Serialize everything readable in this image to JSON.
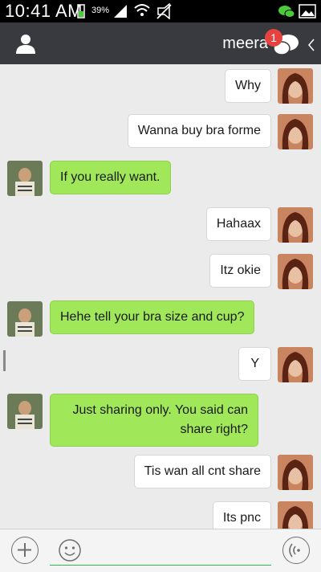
{
  "status_bar": {
    "time": "10:41 AM",
    "battery": "39%"
  },
  "header": {
    "title": "meera",
    "unread_badge": "1"
  },
  "messages": [
    {
      "side": "right",
      "text": "Why"
    },
    {
      "side": "right",
      "text": "Wanna buy bra forme"
    },
    {
      "side": "left",
      "text": "If you really want."
    },
    {
      "side": "right",
      "text": "Hahaax"
    },
    {
      "side": "right",
      "text": "Itz okie"
    },
    {
      "side": "left",
      "text": "Hehe tell your bra size and cup?"
    },
    {
      "side": "right",
      "text": "Y"
    },
    {
      "side": "left",
      "lines": [
        "Just sharing only. You said can",
        "share right?"
      ]
    },
    {
      "side": "right",
      "text": "Tis wan all cnt share"
    },
    {
      "side": "right",
      "text": "Its pnc"
    }
  ],
  "icons": {
    "back": "back-chevron-icon",
    "chat": "chat-bubbles-icon",
    "profile": "person-icon",
    "add": "plus-icon",
    "emoji": "emoji-icon",
    "voice": "voice-icon"
  },
  "colors": {
    "title_bar": "#393a3f",
    "chat_bg": "#ebebeb",
    "sent_bubble": "#a0e75a",
    "received_bubble": "#ffffff",
    "badge": "#e64340"
  }
}
